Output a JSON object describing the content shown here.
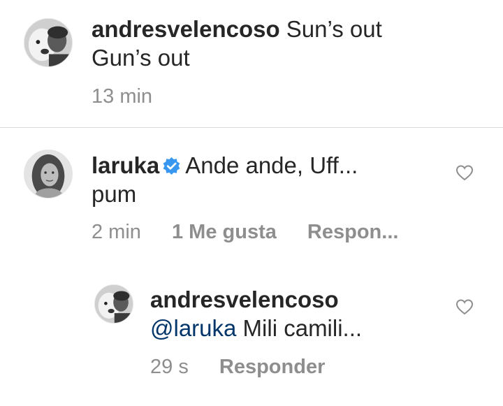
{
  "caption": {
    "username": "andresvelencoso",
    "text_line1": "Sun’s out",
    "text_line2": "Gun’s out",
    "time": "13 min"
  },
  "comment": {
    "username": "laruka",
    "verified_icon": "verified-badge-icon",
    "text_line1": "Ande ande, Uff...",
    "text_line2": "pum",
    "time": "2 min",
    "likes": "1 Me gusta",
    "reply_label": "Respon...",
    "like_icon": "heart-outline-icon"
  },
  "reply": {
    "username": "andresvelencoso",
    "mention": "@laruka",
    "text": " Mili camili...",
    "time": "29 s",
    "reply_label": "Responder",
    "like_icon": "heart-outline-icon"
  },
  "colors": {
    "text": "#262626",
    "meta": "#8e8e8e",
    "mention": "#003569",
    "verified": "#3897f0",
    "divider": "#dbdbdb"
  }
}
